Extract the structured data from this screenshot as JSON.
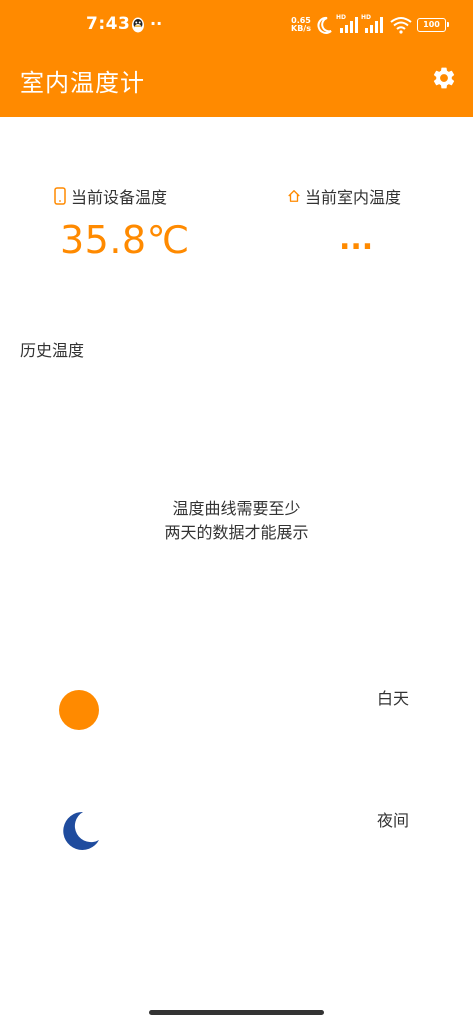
{
  "status_bar": {
    "time": "7:43",
    "dots": "··",
    "net_speed_value": "0.65",
    "net_speed_unit": "KB/s",
    "hd_label": "HD",
    "battery": "100"
  },
  "app": {
    "title": "室内温度计",
    "accent_color": "#ff8a00",
    "settings_icon": "gear-icon"
  },
  "temperatures": {
    "device_label": "当前设备温度",
    "device_value": "35.8℃",
    "room_label": "当前室内温度",
    "room_value": "..."
  },
  "history": {
    "title": "历史温度",
    "empty_line1": "温度曲线需要至少",
    "empty_line2": "两天的数据才能展示"
  },
  "legend": {
    "day_label": "白天",
    "day_color": "#ff8a00",
    "night_label": "夜间",
    "night_color": "#1f4c9e"
  }
}
